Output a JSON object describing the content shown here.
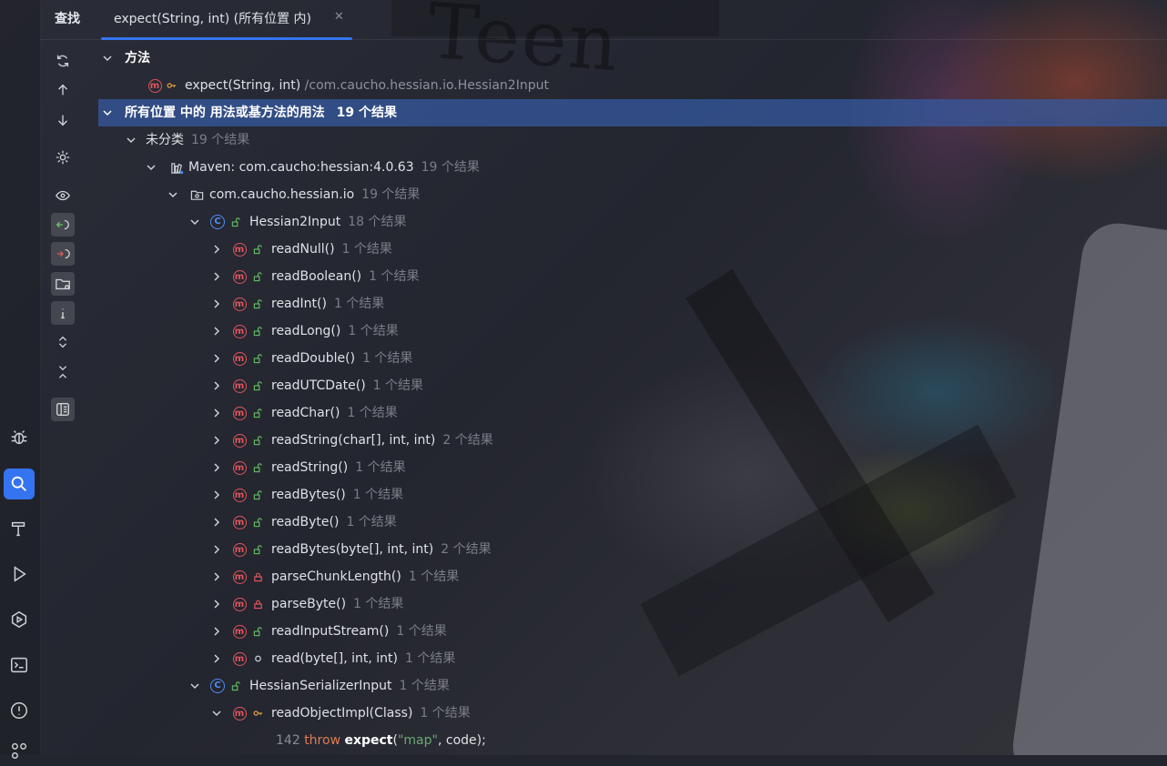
{
  "tabs": {
    "find_label": "查找",
    "active_tab": "expect(String, int) (所有位置 内)",
    "close_glyph": "✕"
  },
  "tree": {
    "methods_header": "方法",
    "target_method": {
      "name": "expect(String, int)",
      "path": "/com.caucho.hessian.io.Hessian2Input"
    },
    "usages_header": {
      "label": "所有位置 中的 用法或基方法的用法",
      "count": "19 个结果"
    },
    "uncategorized": {
      "label": "未分类",
      "count": "19 个结果"
    },
    "maven": {
      "label": "Maven: com.caucho:hessian:4.0.63",
      "count": "19 个结果"
    },
    "package": {
      "label": "com.caucho.hessian.io",
      "count": "19 个结果"
    },
    "class1": {
      "label": "Hessian2Input",
      "count": "18 个结果"
    },
    "methods": [
      {
        "name": "readNull()",
        "count": "1 个结果",
        "visibility": "public"
      },
      {
        "name": "readBoolean()",
        "count": "1 个结果",
        "visibility": "public"
      },
      {
        "name": "readInt()",
        "count": "1 个结果",
        "visibility": "public"
      },
      {
        "name": "readLong()",
        "count": "1 个结果",
        "visibility": "public"
      },
      {
        "name": "readDouble()",
        "count": "1 个结果",
        "visibility": "public"
      },
      {
        "name": "readUTCDate()",
        "count": "1 个结果",
        "visibility": "public"
      },
      {
        "name": "readChar()",
        "count": "1 个结果",
        "visibility": "public"
      },
      {
        "name": "readString(char[], int, int)",
        "count": "2 个结果",
        "visibility": "public"
      },
      {
        "name": "readString()",
        "count": "1 个结果",
        "visibility": "public"
      },
      {
        "name": "readBytes()",
        "count": "1 个结果",
        "visibility": "public"
      },
      {
        "name": "readByte()",
        "count": "1 个结果",
        "visibility": "public"
      },
      {
        "name": "readBytes(byte[], int, int)",
        "count": "2 个结果",
        "visibility": "public"
      },
      {
        "name": "parseChunkLength()",
        "count": "1 个结果",
        "visibility": "private"
      },
      {
        "name": "parseByte()",
        "count": "1 个结果",
        "visibility": "private"
      },
      {
        "name": "readInputStream()",
        "count": "1 个结果",
        "visibility": "public"
      },
      {
        "name": "read(byte[], int, int)",
        "count": "1 个结果",
        "visibility": "package"
      }
    ],
    "class2": {
      "label": "HessianSerializerInput",
      "count": "1 个结果"
    },
    "class2_method": {
      "name": "readObjectImpl(Class)",
      "count": "1 个结果"
    },
    "code_line": {
      "line_no": "142",
      "keyword": "throw",
      "call": "expect",
      "open": "(",
      "string": "\"map\"",
      "rest": ", code);"
    }
  },
  "colors": {
    "accent": "#3574f0",
    "method_icon": "#e0565b",
    "class_icon": "#4f8ef7",
    "public_icon": "#5fb85f",
    "private_icon": "#e0565b"
  }
}
